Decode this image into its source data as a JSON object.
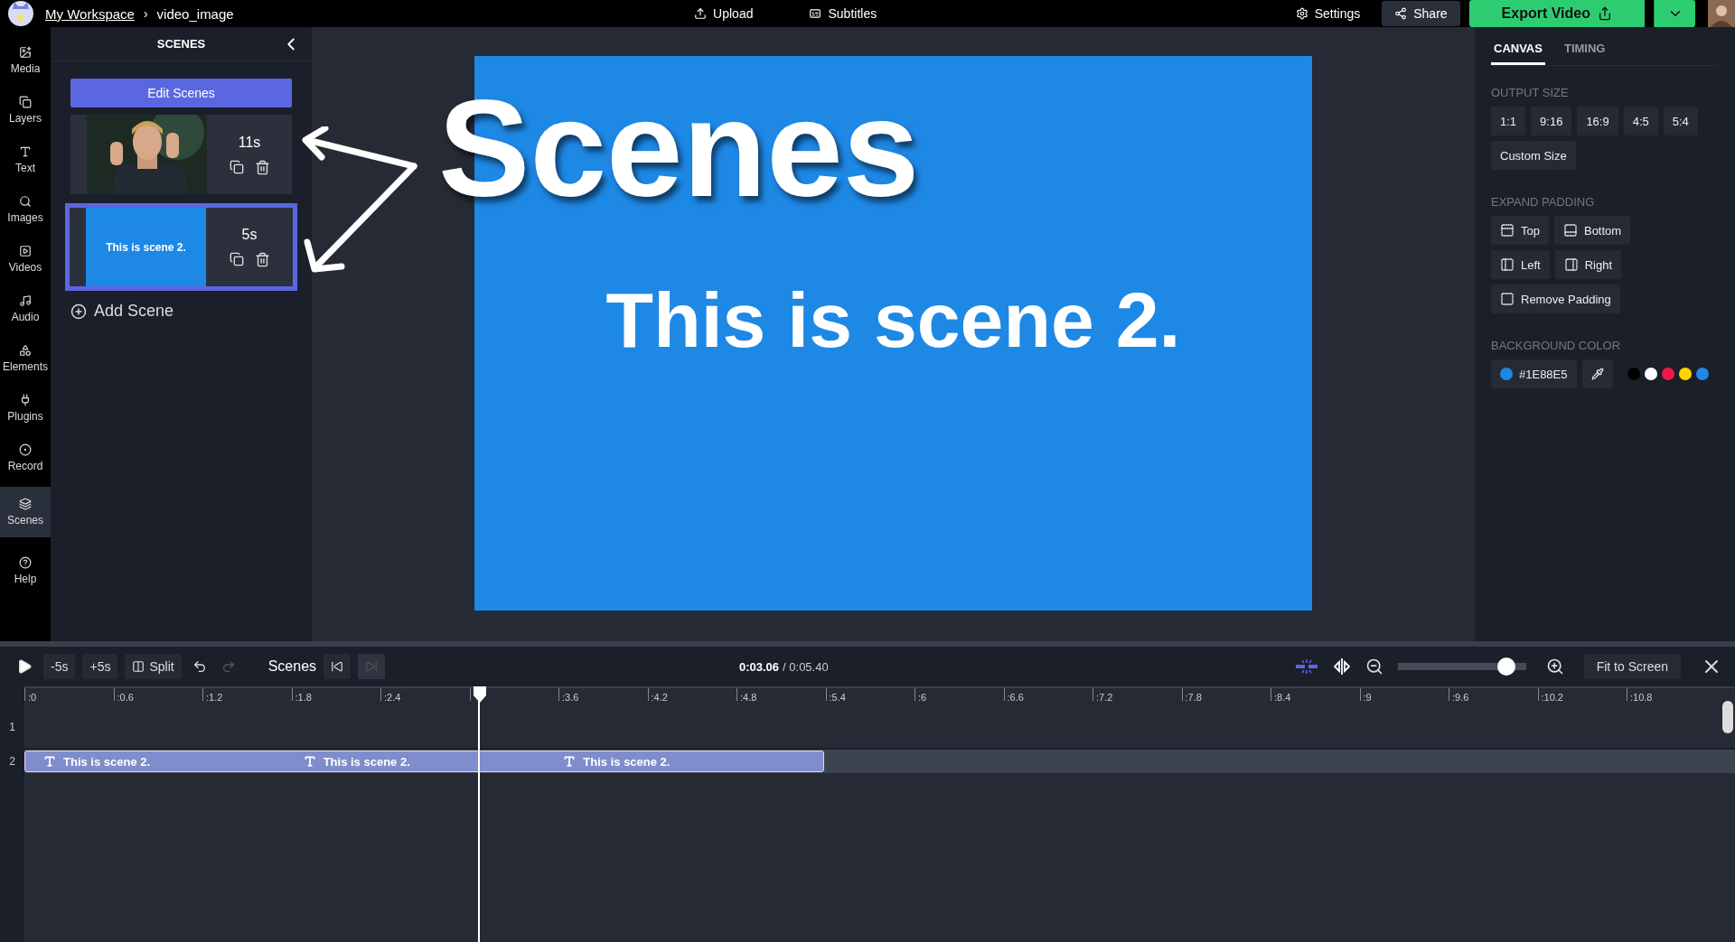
{
  "topbar": {
    "workspace_link": "My Workspace",
    "separator": "›",
    "file_name": "video_image",
    "actions": [
      {
        "label": "Upload"
      },
      {
        "label": "Subtitles"
      }
    ],
    "settings": "Settings",
    "share": "Share",
    "export": "Export Video"
  },
  "rail": [
    {
      "label": "Media",
      "selected": false
    },
    {
      "label": "Layers",
      "selected": false
    },
    {
      "label": "Text",
      "selected": false
    },
    {
      "label": "Images",
      "selected": false
    },
    {
      "label": "Videos",
      "selected": false
    },
    {
      "label": "Audio",
      "selected": false
    },
    {
      "label": "Elements",
      "selected": false
    },
    {
      "label": "Plugins",
      "selected": false
    },
    {
      "label": "Record",
      "selected": false
    },
    {
      "label": "Scenes",
      "selected": true
    },
    {
      "label": "Help",
      "selected": false
    }
  ],
  "scenes_panel": {
    "title": "SCENES",
    "edit_button": "Edit Scenes",
    "scenes": [
      {
        "kind": "picture",
        "duration": "11s",
        "selected": false
      },
      {
        "kind": "text",
        "text": "This is scene 2.",
        "duration": "5s",
        "selected": true
      }
    ],
    "add_scene": "Add Scene"
  },
  "canvas": {
    "text": "This is scene 2."
  },
  "annotation": {
    "label": "Scenes"
  },
  "properties": {
    "tabs": [
      {
        "label": "CANVAS",
        "selected": true
      },
      {
        "label": "TIMING",
        "selected": false
      }
    ],
    "output_size": {
      "heading": "OUTPUT SIZE",
      "options": [
        "1:1",
        "9:16",
        "16:9",
        "4:5",
        "5:4"
      ],
      "custom": "Custom Size"
    },
    "padding": {
      "heading": "EXPAND PADDING",
      "options": [
        "Top",
        "Bottom",
        "Left",
        "Right",
        "Remove Padding"
      ]
    },
    "background": {
      "heading": "BACKGROUND COLOR",
      "value": "#1E88E5",
      "swatches": [
        {
          "color": "#000000"
        },
        {
          "color": "#ffffff"
        },
        {
          "color": "#f0174a"
        },
        {
          "color": "#ffd600"
        },
        {
          "color": "#1e88e5"
        }
      ]
    }
  },
  "timeline": {
    "skip_back": "-5s",
    "skip_forward": "+5s",
    "split": "Split",
    "scenes_label": "Scenes",
    "time_current": "0:03.06",
    "time_total": "/ 0:05.40",
    "zoom": {
      "level": 0.85
    },
    "fit": "Fit to Screen",
    "ruler": [
      {
        "label": ":0"
      },
      {
        "label": ":0.6"
      },
      {
        "label": ":1.2"
      },
      {
        "label": ":1.8"
      },
      {
        "label": ":2.4"
      },
      {
        "kind": "playhead"
      },
      {
        "label": ":3.6"
      },
      {
        "label": ":4.2"
      },
      {
        "label": ":4.8"
      },
      {
        "label": ":5.4"
      },
      {
        "label": ":6"
      },
      {
        "label": ":6.6"
      },
      {
        "label": ":7.2"
      },
      {
        "label": ":7.8"
      },
      {
        "label": ":8.4"
      },
      {
        "label": ":9"
      },
      {
        "label": ":9.6"
      },
      {
        "label": ":10.2"
      },
      {
        "label": ":10.8"
      }
    ],
    "tracks": [
      {
        "number": "1",
        "selected": false
      },
      {
        "number": "2",
        "selected": true,
        "clip": {
          "labels": [
            "This is scene 2.",
            "This is scene 2.",
            "This is scene 2."
          ]
        }
      }
    ]
  }
}
